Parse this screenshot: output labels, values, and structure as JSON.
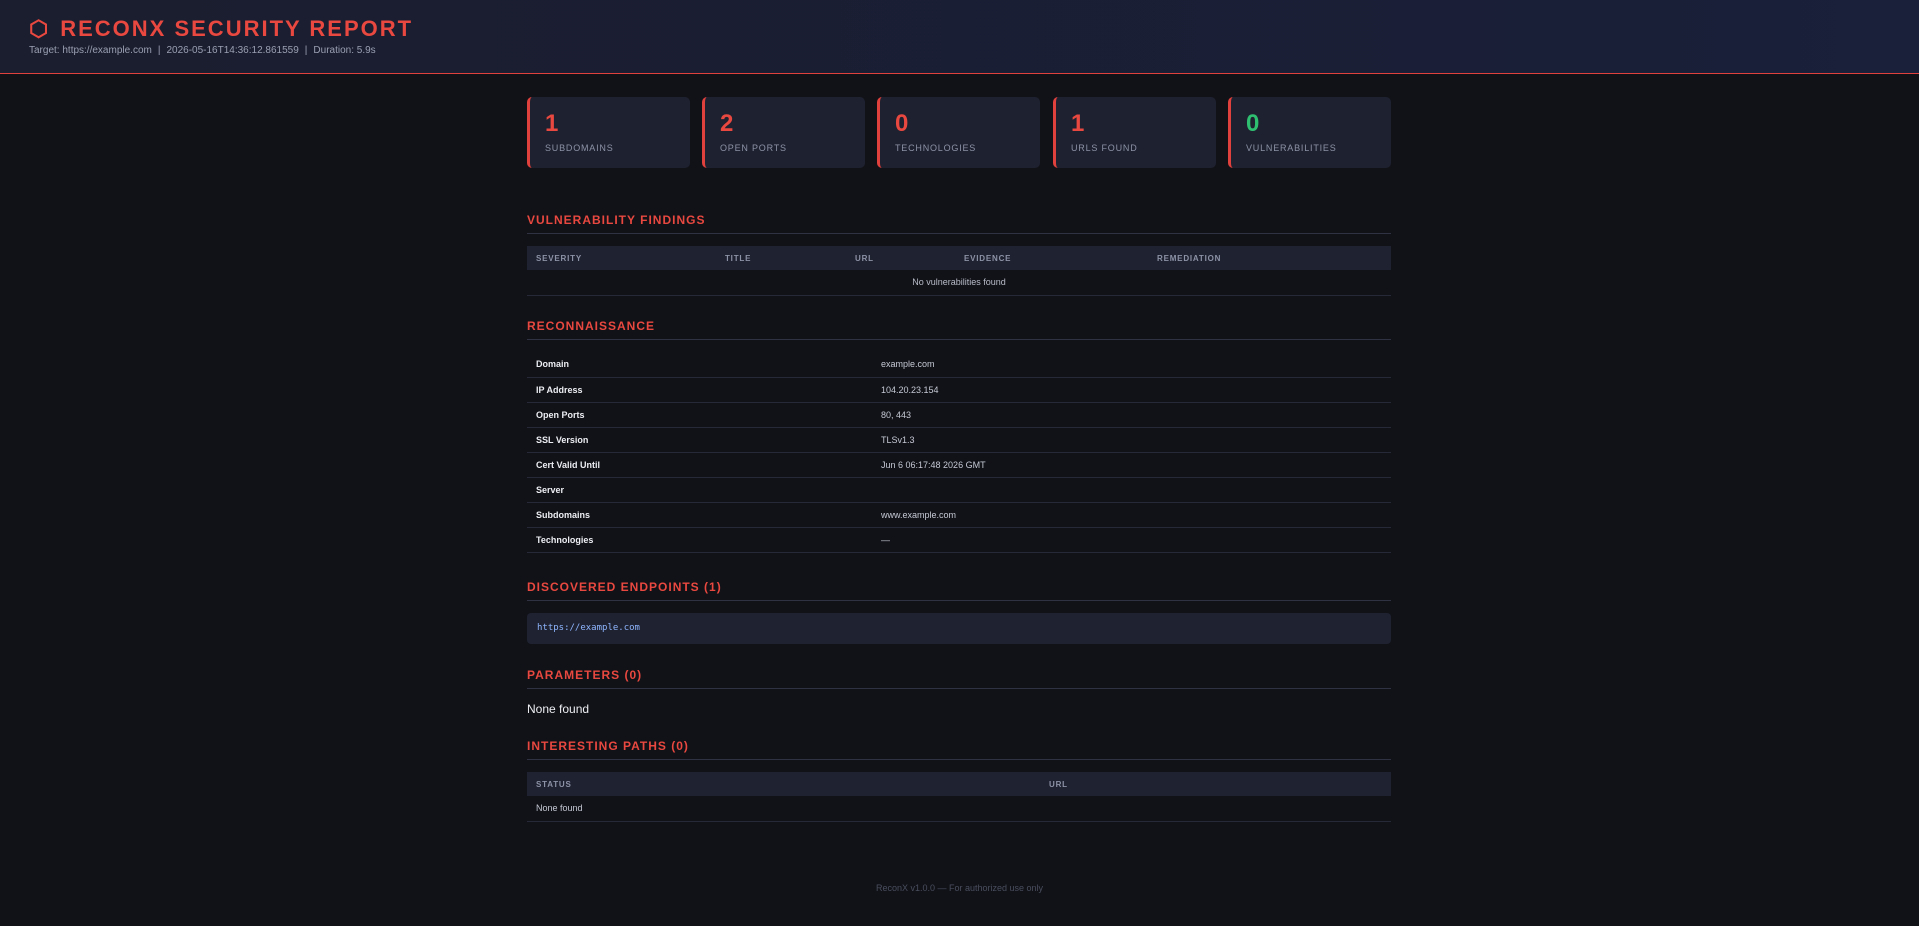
{
  "header": {
    "icon": "hexagon-icon",
    "title": "RECONX SECURITY REPORT",
    "target": "Target: https://example.com",
    "timestamp": "2026-05-16T14:36:12.861559",
    "duration": "Duration: 5.9s"
  },
  "stats": [
    {
      "value": "1",
      "label": "SUBDOMAINS",
      "color": "#e8483f"
    },
    {
      "value": "2",
      "label": "OPEN PORTS",
      "color": "#e8483f"
    },
    {
      "value": "0",
      "label": "TECHNOLOGIES",
      "color": "#e8483f"
    },
    {
      "value": "1",
      "label": "URLS FOUND",
      "color": "#e8483f"
    },
    {
      "value": "0",
      "label": "VULNERABILITIES",
      "color": "#2fbf71"
    }
  ],
  "vulns": {
    "title": "VULNERABILITY FINDINGS",
    "columns": [
      "SEVERITY",
      "TITLE",
      "URL",
      "EVIDENCE",
      "REMEDIATION"
    ],
    "empty": "No vulnerabilities found"
  },
  "recon": {
    "title": "RECONNAISSANCE",
    "rows": [
      {
        "key": "Domain",
        "value": "example.com"
      },
      {
        "key": "IP Address",
        "value": "104.20.23.154"
      },
      {
        "key": "Open Ports",
        "value": "80, 443"
      },
      {
        "key": "SSL Version",
        "value": "TLSv1.3"
      },
      {
        "key": "Cert Valid Until",
        "value": "Jun 6 06:17:48 2026 GMT"
      },
      {
        "key": "Server",
        "value": ""
      },
      {
        "key": "Subdomains",
        "value": "www.example.com"
      },
      {
        "key": "Technologies",
        "value": "—"
      }
    ]
  },
  "endpoints": {
    "title": "DISCOVERED ENDPOINTS (1)",
    "items": [
      "https://example.com"
    ]
  },
  "params": {
    "title": "PARAMETERS (0)",
    "empty": "None found"
  },
  "paths": {
    "title": "INTERESTING PATHS (0)",
    "columns": [
      "STATUS",
      "URL"
    ],
    "empty": "None found"
  },
  "footer": "ReconX v1.0.0 — For authorized use only"
}
